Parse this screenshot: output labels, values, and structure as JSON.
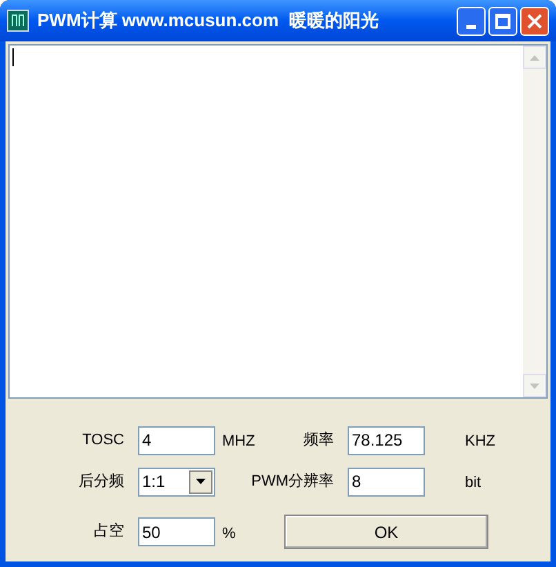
{
  "window": {
    "title": "PWM计算 www.mcusun.com  暖暖的阳光"
  },
  "fields": [
    {
      "label": "TOSC",
      "kind": "input",
      "value": "4",
      "unit": "MHZ"
    },
    {
      "label": "频率",
      "kind": "input",
      "value": "78.125",
      "unit": "KHZ"
    },
    {
      "label": "后分频",
      "kind": "select",
      "value": "1:1"
    },
    {
      "label": "PWM分辨率",
      "kind": "input",
      "value": "8",
      "unit": "bit"
    },
    {
      "label": "占空",
      "kind": "input",
      "value": "50",
      "unit": "%"
    }
  ],
  "buttons": [
    "OK"
  ]
}
